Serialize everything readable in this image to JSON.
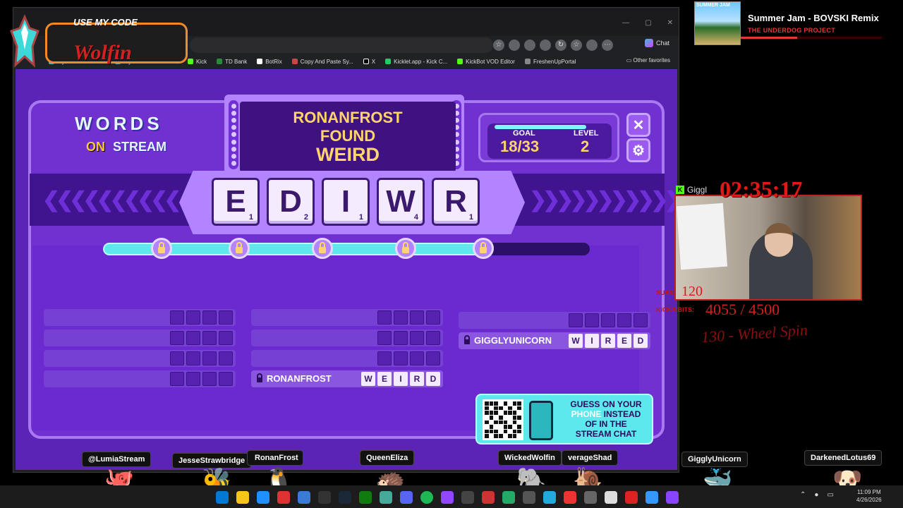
{
  "promo": {
    "title": "USE MY CODE",
    "code": "Wolfin"
  },
  "browser": {
    "chat_label": "Chat",
    "bookmarks": [
      "My Account for In...",
      "My Service Canada...",
      "Kick",
      "TD Bank",
      "BotRix",
      "Copy And Paste Sy...",
      "X",
      "Kicklet.app - Kick C...",
      "KickBot VOD Editor",
      "FreshenUpPortal"
    ],
    "other_favorites": "Other favorites"
  },
  "game": {
    "logo": {
      "words": "WORDS",
      "on": "ON",
      "stream": "STREAM"
    },
    "announce": {
      "line1": "RONANFROST",
      "line2": "FOUND",
      "word": "WEIRD"
    },
    "goal": {
      "label": "GOAL",
      "value": "18/33"
    },
    "level": {
      "label": "LEVEL",
      "value": "2"
    },
    "close_glyph": "✕",
    "settings_glyph": "⚙",
    "tiles": [
      {
        "letter": "E",
        "points": "1"
      },
      {
        "letter": "D",
        "points": "2"
      },
      {
        "letter": "I",
        "points": "1"
      },
      {
        "letter": "W",
        "points": "4"
      },
      {
        "letter": "R",
        "points": "1"
      }
    ],
    "progress": 0.8,
    "found": [
      {
        "name": "RONANFROST",
        "letters": [
          "W",
          "E",
          "I",
          "R",
          "D"
        ]
      },
      {
        "name": "GIGGLYUNICORN",
        "letters": [
          "W",
          "I",
          "R",
          "E",
          "D"
        ]
      }
    ],
    "qr_text": {
      "line1": "GUESS ON YOUR",
      "line2": "PHONE",
      "line2b": "INSTEAD",
      "line3": "OF IN THE",
      "line4": "STREAM CHAT"
    }
  },
  "chat_labels": [
    "@LumiaStream",
    "JesseStrawbridge",
    "RonanFrost",
    "QueenEliza",
    "WickedWolfin",
    "verageShad",
    "GigglyUnicorn",
    "DarkenedLotus69"
  ],
  "music": {
    "art_title": "SUMMER JAM",
    "title": "Summer Jam - BOVSKI Remix",
    "artist": "THE UNDERDOG PROJECT",
    "progress": 0.4
  },
  "stream": {
    "timer": "02:35:17",
    "cam_user": "Giggl",
    "subs_label": "SUBS:",
    "subs_value": "120",
    "kicks_label": "KICKS/BITS:",
    "kicks_value": "4055 / 4500",
    "wheel": "130 - Wheel Spin"
  },
  "clock": {
    "time": "11:09 PM",
    "date": "4/26/2026"
  }
}
